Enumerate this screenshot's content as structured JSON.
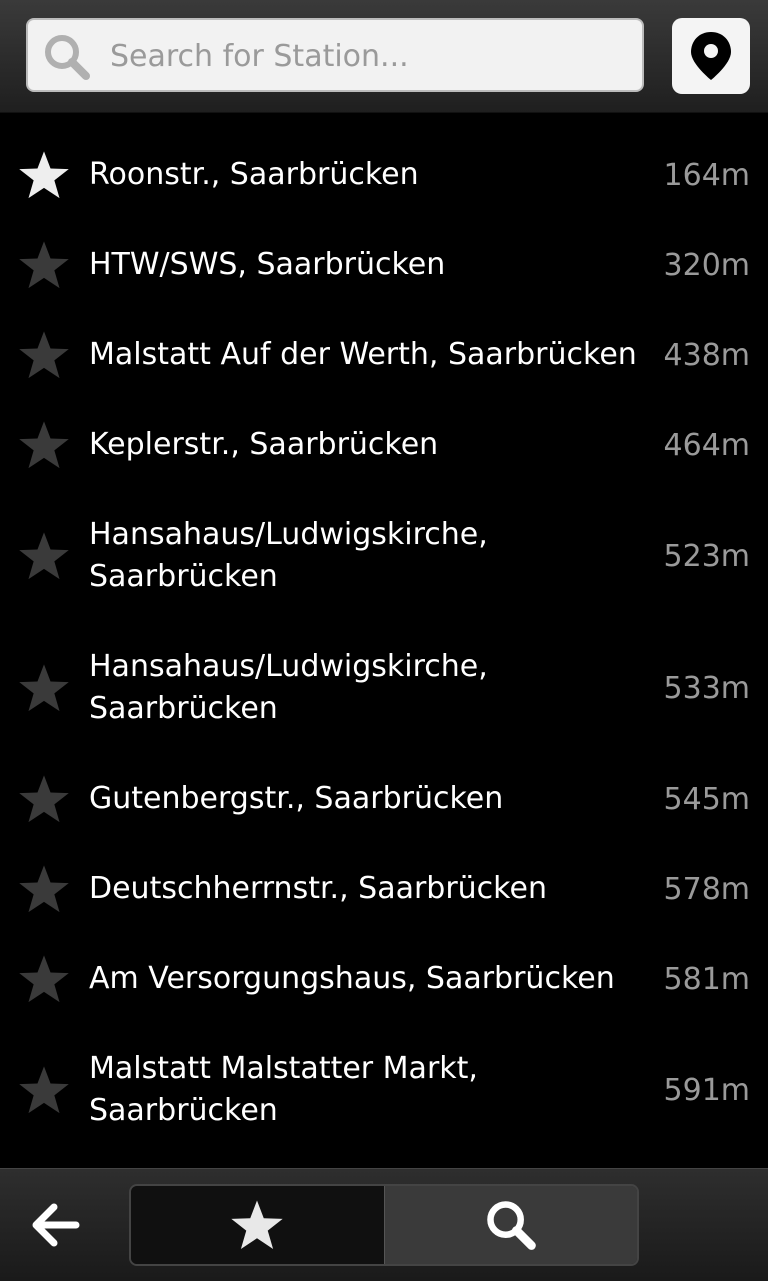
{
  "search": {
    "placeholder": "Search for Station...",
    "value": ""
  },
  "icons": {
    "search": "search-icon",
    "locate": "location-pin-icon",
    "star": "star-icon",
    "back": "arrow-left-icon"
  },
  "colors": {
    "background": "#000000",
    "text": "#ffffff",
    "distance": "#9a9a9a",
    "star_active": "#eeeeee",
    "star_inactive": "#3a3a3a"
  },
  "stations": [
    {
      "name": "Roonstr., Saarbrücken",
      "distance": "164m",
      "favorite": true
    },
    {
      "name": "HTW/SWS, Saarbrücken",
      "distance": "320m",
      "favorite": false
    },
    {
      "name": "Malstatt Auf der Werth, Saarbrücken",
      "distance": "438m",
      "favorite": false
    },
    {
      "name": "Keplerstr., Saarbrücken",
      "distance": "464m",
      "favorite": false
    },
    {
      "name": "Hansahaus/Ludwigskirche, Saarbrücken",
      "distance": "523m",
      "favorite": false
    },
    {
      "name": "Hansahaus/Ludwigskirche, Saarbrücken",
      "distance": "533m",
      "favorite": false
    },
    {
      "name": "Gutenbergstr., Saarbrücken",
      "distance": "545m",
      "favorite": false
    },
    {
      "name": "Deutschherrnstr., Saarbrücken",
      "distance": "578m",
      "favorite": false
    },
    {
      "name": "Am Versorgungshaus, Saarbrücken",
      "distance": "581m",
      "favorite": false
    },
    {
      "name": "Malstatt Malstatter Markt, Saarbrücken",
      "distance": "591m",
      "favorite": false
    }
  ],
  "footer": {
    "tabs": [
      {
        "icon": "star-icon",
        "selected": false
      },
      {
        "icon": "search-icon",
        "selected": true
      }
    ]
  }
}
